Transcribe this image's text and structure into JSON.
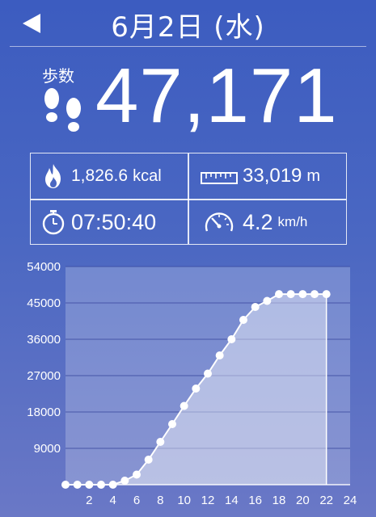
{
  "header": {
    "title": "6月2日 (水)"
  },
  "steps": {
    "label": "歩数",
    "value": "47,171"
  },
  "stats": {
    "calories": {
      "value": "1,826.6",
      "unit": "kcal"
    },
    "distance": {
      "value": "33,019",
      "unit": "m"
    },
    "duration": {
      "value": "07:50:40"
    },
    "speed": {
      "value": "4.2",
      "unit": "km/h"
    }
  },
  "chart_data": {
    "type": "area",
    "title": "",
    "xlabel": "",
    "ylabel": "",
    "x": [
      0,
      1,
      2,
      3,
      4,
      5,
      6,
      7,
      8,
      9,
      10,
      11,
      12,
      13,
      14,
      15,
      16,
      17,
      18,
      19,
      20,
      21,
      22
    ],
    "values": [
      0,
      0,
      0,
      0,
      0,
      1000,
      2500,
      6200,
      10600,
      15000,
      19500,
      23800,
      27500,
      32000,
      36000,
      40800,
      44000,
      45500,
      47171,
      47171,
      47171,
      47171,
      47171
    ],
    "xlim": [
      0,
      24
    ],
    "ylim": [
      0,
      54000
    ],
    "x_ticks": [
      2,
      4,
      6,
      8,
      10,
      12,
      14,
      16,
      18,
      20,
      22,
      24
    ],
    "y_ticks": [
      9000,
      18000,
      27000,
      36000,
      45000,
      54000
    ],
    "y_tick_labels": [
      "9000",
      "18000",
      "27000",
      "36000",
      "45000",
      "54000"
    ]
  }
}
